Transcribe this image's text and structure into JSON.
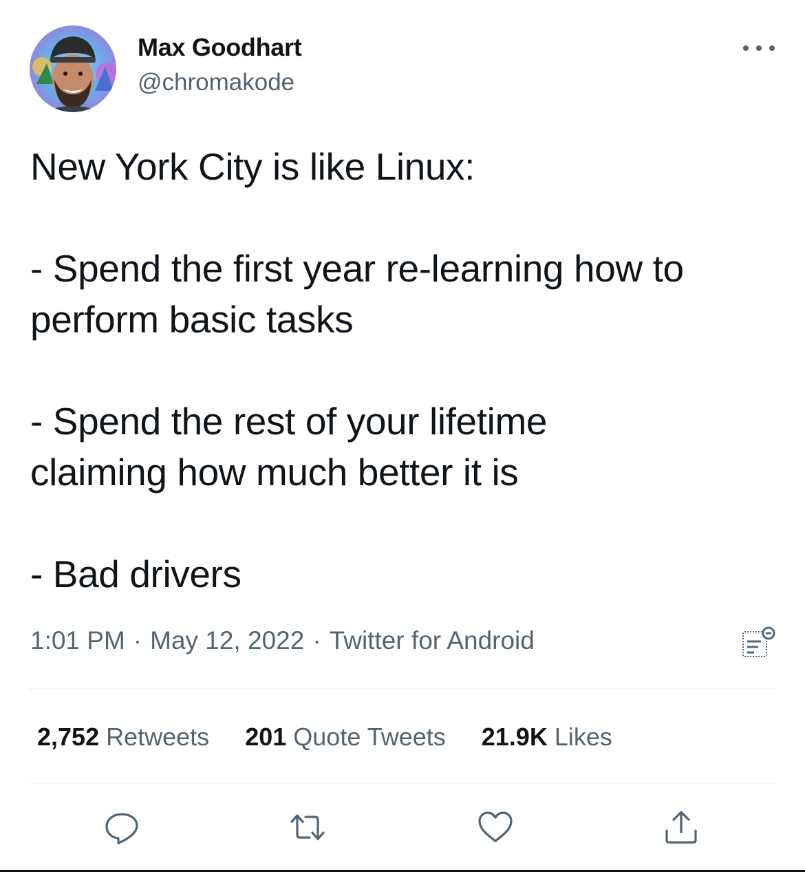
{
  "author": {
    "name": "Max Goodhart",
    "handle": "@chromakode"
  },
  "tweet": {
    "line1": "New York City is like Linux:",
    "line2": "- Spend the first year re-learning how to",
    "line3": "perform basic tasks",
    "line4": "- Spend the rest of your lifetime",
    "line5": "claiming how much better it is",
    "line6": "- Bad drivers"
  },
  "meta": {
    "time": "1:01 PM",
    "date": "May 12, 2022",
    "source": "Twitter for Android",
    "separator": "·"
  },
  "stats": {
    "retweets_count": "2,752",
    "retweets_label": "Retweets",
    "quotes_count": "201",
    "quotes_label": "Quote Tweets",
    "likes_count": "21.9K",
    "likes_label": "Likes"
  },
  "icons": {
    "more": "more-dots-icon",
    "analytics": "analytics-icon",
    "reply": "reply-icon",
    "retweet": "retweet-icon",
    "like": "heart-icon",
    "share": "share-icon"
  },
  "colors": {
    "text": "#0f1419",
    "secondary": "#536471",
    "divider": "#eff3f4"
  }
}
